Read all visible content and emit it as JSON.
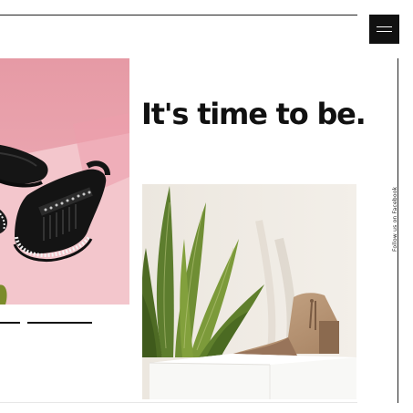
{
  "header": {
    "menu_icon": "hamburger-menu-icon"
  },
  "hero": {
    "headline": "It's time to be.",
    "left_image": "sandals-on-pink-background",
    "right_image": "suede-ankle-boot-with-snake-plant"
  },
  "sidebar": {
    "follow_text": "Follow us on Facebook"
  },
  "slider": {
    "indicator_count": 2
  },
  "colors": {
    "text": "#111111",
    "accent_pink": "#e8a2ab",
    "background": "#ffffff"
  }
}
